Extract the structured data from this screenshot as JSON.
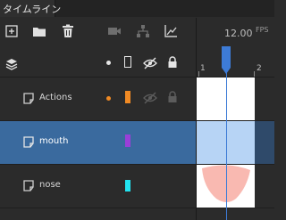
{
  "panel": {
    "tab_label": "タイムライン"
  },
  "toolbar": {
    "left_icons": [
      "new-layer-icon",
      "folder-icon",
      "trash-icon"
    ],
    "right_icons": [
      "camera-icon",
      "hierarchy-icon",
      "graph-icon"
    ],
    "fps_value": "12.00",
    "fps_unit": "FPS"
  },
  "header": {
    "columns": [
      "layers-stack-icon",
      "dot-column-icon",
      "outline-column-icon",
      "visibility-column-icon",
      "lock-column-icon"
    ]
  },
  "ruler": {
    "frames": [
      "1",
      "2"
    ],
    "current_frame": 1
  },
  "layers": [
    {
      "name": "Actions",
      "color": "#f08a24",
      "has_dot": true,
      "dot_color": "#f08a24",
      "selected": false,
      "keyframe_content": "empty"
    },
    {
      "name": "mouth",
      "color": "#9a3fd8",
      "has_dot": false,
      "selected": true,
      "keyframe_content": "empty"
    },
    {
      "name": "nose",
      "color": "#22e3f0",
      "has_dot": false,
      "selected": false,
      "keyframe_content": "pink-shape"
    }
  ],
  "colors": {
    "selection": "#3a6a9e",
    "selected_frame": "#b7d4f5",
    "playhead": "#3d7bd6",
    "nose_shape": "#f9b9b1"
  }
}
